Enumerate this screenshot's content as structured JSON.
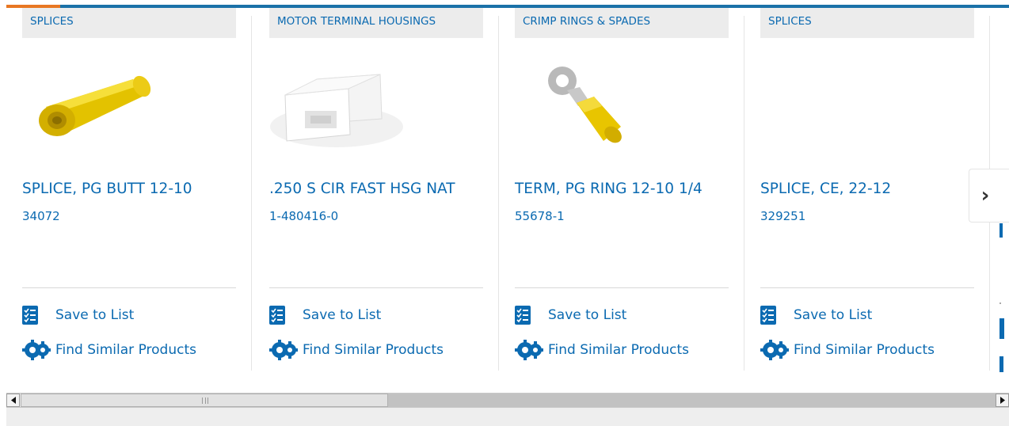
{
  "colors": {
    "accent": "#e87722",
    "brand_blue": "#1a71a8",
    "link": "#0b6ab1"
  },
  "products": [
    {
      "category": "SPLICES",
      "title": "SPLICE, PG BUTT 12-10",
      "part_number": "34072",
      "image_icon": "yellow-butt-splice-image",
      "save_label": "Save to List",
      "similar_label": "Find Similar Products"
    },
    {
      "category": "MOTOR TERMINAL HOUSINGS",
      "title": ".250 S CIR FAST HSG NAT",
      "part_number": "1-480416-0",
      "image_icon": "white-housing-image",
      "save_label": "Save to List",
      "similar_label": "Find Similar Products"
    },
    {
      "category": "CRIMP RINGS & SPADES",
      "title": "TERM, PG RING 12-10 1/4",
      "part_number": "55678-1",
      "image_icon": "ring-terminal-image",
      "save_label": "Save to List",
      "similar_label": "Find Similar Products"
    },
    {
      "category": "SPLICES",
      "title": "SPLICE, CE, 22-12",
      "part_number": "329251",
      "image_icon": "",
      "save_label": "Save to List",
      "similar_label": "Find Similar Products"
    }
  ],
  "carousel": {
    "next_icon": "chevron-right-icon",
    "next_glyph": "›"
  },
  "scrollbar": {
    "left_icon": "triangle-left-icon",
    "right_icon": "triangle-right-icon"
  }
}
